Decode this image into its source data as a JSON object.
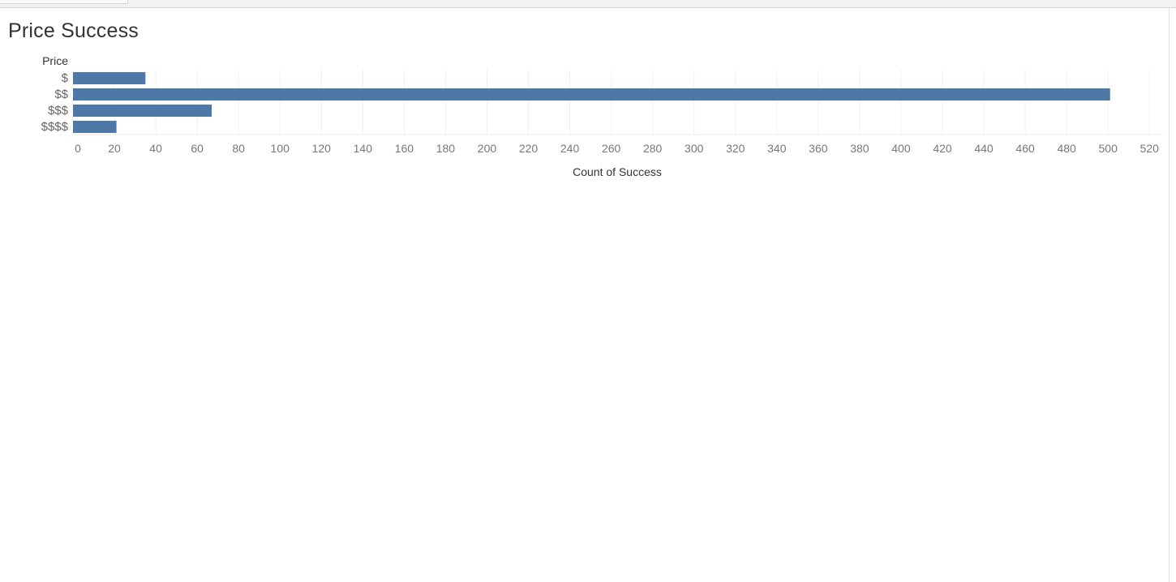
{
  "page": {
    "title": "Price Success"
  },
  "chart_data": {
    "type": "bar",
    "orientation": "horizontal",
    "title": "Price Success",
    "category_axis_title": "Price",
    "categories": [
      "$",
      "$$",
      "$$$",
      "$$$$"
    ],
    "values": [
      35,
      501,
      67,
      21
    ],
    "xlabel": "Count of Success",
    "xlim": [
      0,
      525
    ],
    "x_ticks": [
      0,
      20,
      40,
      60,
      80,
      100,
      120,
      140,
      160,
      180,
      200,
      220,
      240,
      260,
      280,
      300,
      320,
      340,
      360,
      380,
      400,
      420,
      440,
      460,
      480,
      500,
      520
    ],
    "grid": "vertical",
    "legend": "none",
    "colors": {
      "bar": "#4e79a7",
      "grid": "#f0f0f0"
    }
  }
}
